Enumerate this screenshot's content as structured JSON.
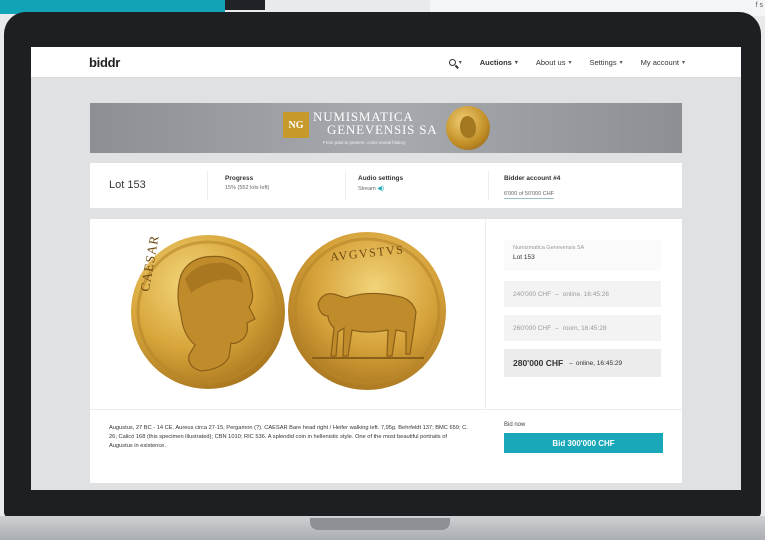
{
  "scene": {
    "corner_text": "f s"
  },
  "navbar": {
    "logo": "biddr",
    "items": [
      {
        "label": "Auctions",
        "bold": true
      },
      {
        "label": "About us"
      },
      {
        "label": "Settings"
      },
      {
        "label": "My account"
      }
    ]
  },
  "banner": {
    "monogram": "NG",
    "name_line1": "NUMISMATICA",
    "name_line2": "GENEVENSIS SA",
    "tagline": "From past to present, coins reveal history"
  },
  "info": {
    "lot": "Lot 153",
    "progress_title": "Progress",
    "progress_value": "15% (552 lots left)",
    "progress_fraction": 0.15,
    "audio_title": "Audio settings",
    "audio_value": "Stream",
    "account_title": "Bidder account #4",
    "account_value": "6'000 of 50'000 CHF"
  },
  "coins": {
    "obverse_legend": "CAESAR",
    "reverse_legend": "AVGVSTVS"
  },
  "bids": {
    "auctioneer": "Numismatica Genevensis SA",
    "lot": "Lot 153",
    "history": [
      {
        "amount": "240'000 CHF",
        "source": "online, 16:45:26"
      },
      {
        "amount": "260'000 CHF",
        "source": "room, 16:45:28"
      }
    ],
    "latest": {
      "amount": "280'000 CHF",
      "source": "online, 16:45:29"
    }
  },
  "description": "Augustus, 27 BC - 14 CE. Aureus circa 27-15, Pergamon (?). CAESAR Bare head right / Heifer walking left. 7,95g. Behrfeldt 137; BMC 659; C. 26; Calicó 168 (this specimen illustrated); CBN 1010; RIC 536. A splendid coin in hellenistic style. One of the most beautiful portraits of Augustus in existence.",
  "bid_now": {
    "label": "Bid now",
    "button": "Bid 300'000 CHF"
  },
  "colors": {
    "accent": "#18a8b9",
    "gold": "#d6a23a",
    "banner": "#9a9da1"
  }
}
